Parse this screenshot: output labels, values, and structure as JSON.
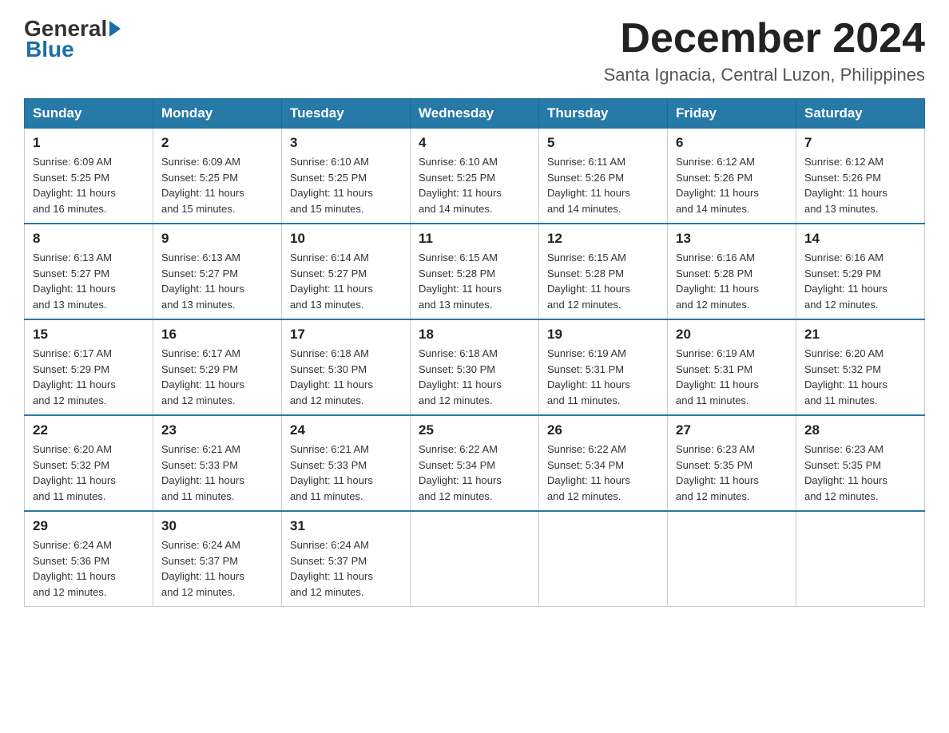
{
  "header": {
    "logo_general": "General",
    "logo_blue": "Blue",
    "month_title": "December 2024",
    "location": "Santa Ignacia, Central Luzon, Philippines"
  },
  "days_of_week": [
    "Sunday",
    "Monday",
    "Tuesday",
    "Wednesday",
    "Thursday",
    "Friday",
    "Saturday"
  ],
  "weeks": [
    [
      {
        "day": "1",
        "sunrise": "6:09 AM",
        "sunset": "5:25 PM",
        "daylight": "11 hours and 16 minutes."
      },
      {
        "day": "2",
        "sunrise": "6:09 AM",
        "sunset": "5:25 PM",
        "daylight": "11 hours and 15 minutes."
      },
      {
        "day": "3",
        "sunrise": "6:10 AM",
        "sunset": "5:25 PM",
        "daylight": "11 hours and 15 minutes."
      },
      {
        "day": "4",
        "sunrise": "6:10 AM",
        "sunset": "5:25 PM",
        "daylight": "11 hours and 14 minutes."
      },
      {
        "day": "5",
        "sunrise": "6:11 AM",
        "sunset": "5:26 PM",
        "daylight": "11 hours and 14 minutes."
      },
      {
        "day": "6",
        "sunrise": "6:12 AM",
        "sunset": "5:26 PM",
        "daylight": "11 hours and 14 minutes."
      },
      {
        "day": "7",
        "sunrise": "6:12 AM",
        "sunset": "5:26 PM",
        "daylight": "11 hours and 13 minutes."
      }
    ],
    [
      {
        "day": "8",
        "sunrise": "6:13 AM",
        "sunset": "5:27 PM",
        "daylight": "11 hours and 13 minutes."
      },
      {
        "day": "9",
        "sunrise": "6:13 AM",
        "sunset": "5:27 PM",
        "daylight": "11 hours and 13 minutes."
      },
      {
        "day": "10",
        "sunrise": "6:14 AM",
        "sunset": "5:27 PM",
        "daylight": "11 hours and 13 minutes."
      },
      {
        "day": "11",
        "sunrise": "6:15 AM",
        "sunset": "5:28 PM",
        "daylight": "11 hours and 13 minutes."
      },
      {
        "day": "12",
        "sunrise": "6:15 AM",
        "sunset": "5:28 PM",
        "daylight": "11 hours and 12 minutes."
      },
      {
        "day": "13",
        "sunrise": "6:16 AM",
        "sunset": "5:28 PM",
        "daylight": "11 hours and 12 minutes."
      },
      {
        "day": "14",
        "sunrise": "6:16 AM",
        "sunset": "5:29 PM",
        "daylight": "11 hours and 12 minutes."
      }
    ],
    [
      {
        "day": "15",
        "sunrise": "6:17 AM",
        "sunset": "5:29 PM",
        "daylight": "11 hours and 12 minutes."
      },
      {
        "day": "16",
        "sunrise": "6:17 AM",
        "sunset": "5:29 PM",
        "daylight": "11 hours and 12 minutes."
      },
      {
        "day": "17",
        "sunrise": "6:18 AM",
        "sunset": "5:30 PM",
        "daylight": "11 hours and 12 minutes."
      },
      {
        "day": "18",
        "sunrise": "6:18 AM",
        "sunset": "5:30 PM",
        "daylight": "11 hours and 12 minutes."
      },
      {
        "day": "19",
        "sunrise": "6:19 AM",
        "sunset": "5:31 PM",
        "daylight": "11 hours and 11 minutes."
      },
      {
        "day": "20",
        "sunrise": "6:19 AM",
        "sunset": "5:31 PM",
        "daylight": "11 hours and 11 minutes."
      },
      {
        "day": "21",
        "sunrise": "6:20 AM",
        "sunset": "5:32 PM",
        "daylight": "11 hours and 11 minutes."
      }
    ],
    [
      {
        "day": "22",
        "sunrise": "6:20 AM",
        "sunset": "5:32 PM",
        "daylight": "11 hours and 11 minutes."
      },
      {
        "day": "23",
        "sunrise": "6:21 AM",
        "sunset": "5:33 PM",
        "daylight": "11 hours and 11 minutes."
      },
      {
        "day": "24",
        "sunrise": "6:21 AM",
        "sunset": "5:33 PM",
        "daylight": "11 hours and 11 minutes."
      },
      {
        "day": "25",
        "sunrise": "6:22 AM",
        "sunset": "5:34 PM",
        "daylight": "11 hours and 12 minutes."
      },
      {
        "day": "26",
        "sunrise": "6:22 AM",
        "sunset": "5:34 PM",
        "daylight": "11 hours and 12 minutes."
      },
      {
        "day": "27",
        "sunrise": "6:23 AM",
        "sunset": "5:35 PM",
        "daylight": "11 hours and 12 minutes."
      },
      {
        "day": "28",
        "sunrise": "6:23 AM",
        "sunset": "5:35 PM",
        "daylight": "11 hours and 12 minutes."
      }
    ],
    [
      {
        "day": "29",
        "sunrise": "6:24 AM",
        "sunset": "5:36 PM",
        "daylight": "11 hours and 12 minutes."
      },
      {
        "day": "30",
        "sunrise": "6:24 AM",
        "sunset": "5:37 PM",
        "daylight": "11 hours and 12 minutes."
      },
      {
        "day": "31",
        "sunrise": "6:24 AM",
        "sunset": "5:37 PM",
        "daylight": "11 hours and 12 minutes."
      },
      null,
      null,
      null,
      null
    ]
  ],
  "labels": {
    "sunrise": "Sunrise: ",
    "sunset": "Sunset: ",
    "daylight": "Daylight: "
  }
}
